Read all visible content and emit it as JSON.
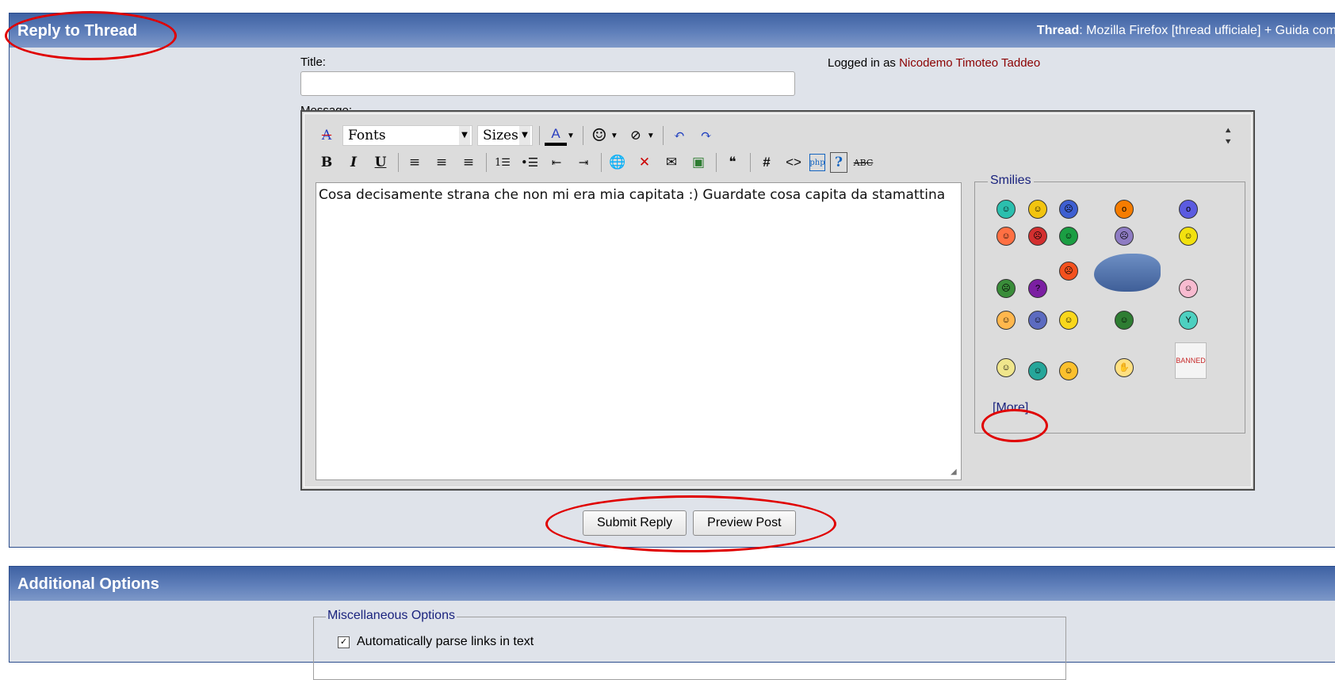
{
  "reply_panel": {
    "heading": "Reply to Thread",
    "thread_label": "Thread",
    "thread_title": ": Mozilla Firefox [thread ufficiale] + Guida com"
  },
  "form": {
    "title_label": "Title:",
    "title_value": "",
    "logged_prefix": "Logged in as ",
    "username": "Nicodemo Timoteo Taddeo",
    "message_label": "Message:"
  },
  "editor": {
    "fonts_select": "Fonts",
    "sizes_select": "Sizes",
    "message_text": "Cosa decisamente strana che non mi era mia capitata :) Guardate cosa capita da stamattina",
    "toolbar_icons": [
      "remove-format-icon",
      "font-color-icon",
      "smilie-icon",
      "attachment-icon",
      "undo-icon",
      "redo-icon",
      "bold-icon",
      "italic-icon",
      "underline-icon",
      "align-left-icon",
      "align-center-icon",
      "align-right-icon",
      "ordered-list-icon",
      "unordered-list-icon",
      "outdent-icon",
      "indent-icon",
      "insert-link-icon",
      "remove-link-icon",
      "insert-email-icon",
      "insert-image-icon",
      "quote-icon",
      "wrap-code-icon",
      "html-icon",
      "php-icon",
      "help-icon",
      "spell-check-icon"
    ]
  },
  "smilies": {
    "legend": "Smilies",
    "more_link": "[More]"
  },
  "actions": {
    "submit": "Submit Reply",
    "preview": "Preview Post"
  },
  "options_panel": {
    "heading": "Additional Options",
    "misc_legend": "Miscellaneous Options",
    "auto_parse_links": "Automatically parse links in text",
    "auto_parse_checked": true
  },
  "colors": {
    "header_gradient_top": "#3f62a3",
    "panel_bg": "#dfe3ea",
    "username": "#8b0000",
    "legend": "#1a237e",
    "annotation_red": "#e00000"
  }
}
